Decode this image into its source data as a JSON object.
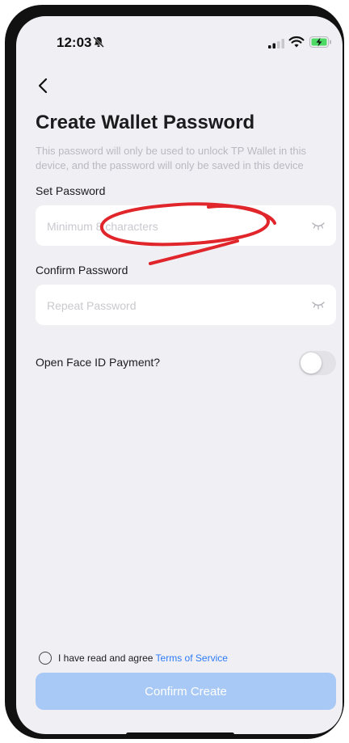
{
  "status_bar": {
    "time": "12:03",
    "icons": [
      "bell-slash-icon",
      "signal-icon",
      "wifi-icon",
      "battery-charging-icon"
    ],
    "battery_color": "#4cd964"
  },
  "nav": {
    "back_icon": "chevron-left-icon"
  },
  "title": "Create Wallet Password",
  "subtitle": "This password will only be used to unlock TP Wallet in this device, and the password will only be saved in this device",
  "set_password": {
    "label": "Set Password",
    "placeholder": "Minimum 8 characters",
    "value": "",
    "visibility_icon": "eye-closed-icon"
  },
  "confirm_password": {
    "label": "Confirm Password",
    "placeholder": "Repeat Password",
    "value": "",
    "visibility_icon": "eye-closed-icon"
  },
  "face_id": {
    "label": "Open Face ID Payment?",
    "enabled": false
  },
  "agreement": {
    "text": "I have read and agree ",
    "link": "Terms of Service",
    "checked": false
  },
  "confirm_button": {
    "label": "Confirm Create",
    "enabled": false
  },
  "colors": {
    "background": "#f0eff4",
    "accent": "#2d7cf6",
    "button_disabled": "#a8c9f5",
    "annotation": "#e0252b"
  }
}
